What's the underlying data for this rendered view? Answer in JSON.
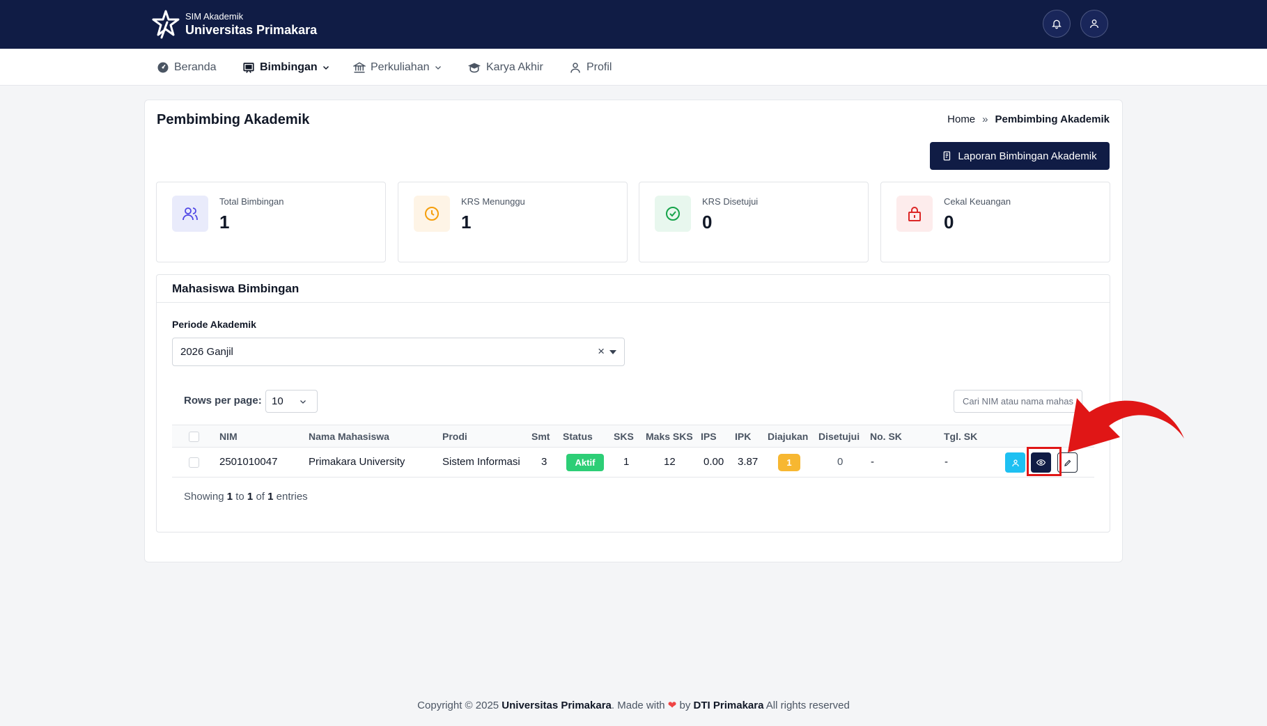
{
  "header": {
    "app_sub": "SIM Akademik",
    "app_name": "Universitas Primakara",
    "icons": [
      "bell-icon",
      "user-icon"
    ]
  },
  "nav": {
    "items": [
      {
        "label": "Beranda",
        "icon": "dashboard-icon"
      },
      {
        "label": "Bimbingan",
        "icon": "board-icon",
        "active": true,
        "dropdown": true
      },
      {
        "label": "Perkuliahan",
        "icon": "building-icon",
        "dropdown": true
      },
      {
        "label": "Karya Akhir",
        "icon": "graduation-cap-icon"
      },
      {
        "label": "Profil",
        "icon": "user-icon"
      }
    ]
  },
  "page": {
    "title": "Pembimbing Akademik",
    "breadcrumb": {
      "home": "Home",
      "separator": "»",
      "current": "Pembimbing Akademik"
    },
    "report_button": "Laporan Bimbingan Akademik"
  },
  "stats": [
    {
      "label": "Total Bimbingan",
      "value": "1",
      "icon": "users-icon",
      "color": "#4f46e5"
    },
    {
      "label": "KRS Menunggu",
      "value": "1",
      "icon": "clock-icon",
      "color": "#f59e0b"
    },
    {
      "label": "KRS Disetujui",
      "value": "0",
      "icon": "check-circle-icon",
      "color": "#16a34a"
    },
    {
      "label": "Cekal Keuangan",
      "value": "0",
      "icon": "lock-icon",
      "color": "#dc2626"
    }
  ],
  "students": {
    "title": "Mahasiswa Bimbingan",
    "periode_label": "Periode Akademik",
    "periode_value": "2026 Ganjil",
    "periode_clear": "×",
    "rows_label": "Rows per page:",
    "rows_value": "10",
    "search_placeholder": "Cari NIM atau nama mahasiswa",
    "columns": [
      "NIM",
      "Nama Mahasiswa",
      "Prodi",
      "Smt",
      "Status",
      "SKS",
      "Maks SKS",
      "IPS",
      "IPK",
      "Diajukan",
      "Disetujui",
      "No. SK",
      "Tgl. SK"
    ],
    "rows": [
      {
        "nim": "2501010047",
        "nama": "Primakara University",
        "prodi": "Sistem Informasi",
        "smt": "3",
        "status": "Aktif",
        "sks": "1",
        "maks_sks": "12",
        "ips": "0.00",
        "ipk": "3.87",
        "diajukan": "1",
        "disetujui": "0",
        "no_sk": "-",
        "tgl_sk": "-"
      }
    ],
    "showing": {
      "prefix": "Showing",
      "from": "1",
      "to_word": "to",
      "to": "1",
      "of_word": "of",
      "total": "1",
      "suffix": "entries"
    }
  },
  "annotation": {
    "color": "#e01616"
  },
  "footer": {
    "prefix": "Copyright © 2025",
    "org": "Universitas Primakara",
    "made_with": ". Made with",
    "by": "by",
    "team": "DTI Primakara",
    "suffix": "All rights reserved"
  }
}
